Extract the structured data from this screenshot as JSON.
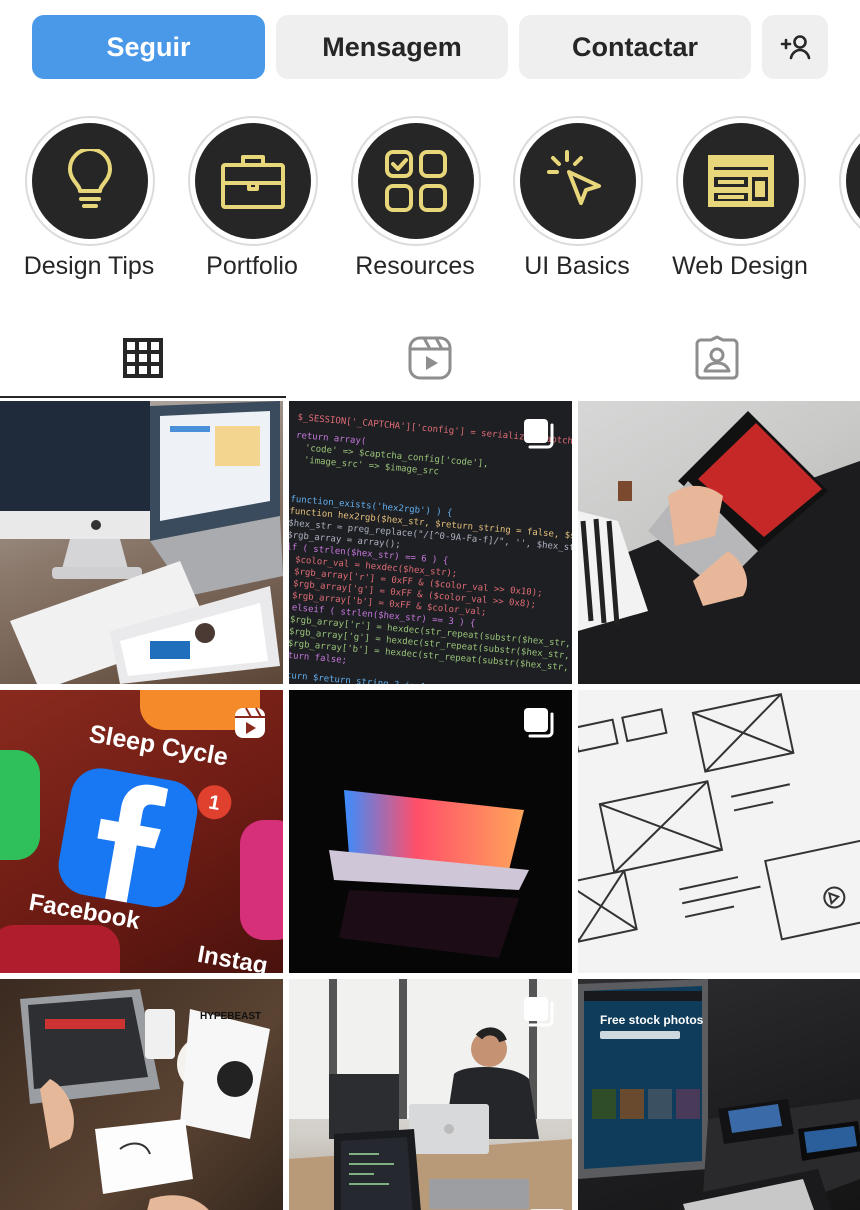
{
  "actions": {
    "follow_label": "Seguir",
    "message_label": "Mensagem",
    "contact_label": "Contactar",
    "add_person_icon": "add-person-icon"
  },
  "highlights": [
    {
      "label": "Design Tips",
      "icon": "lightbulb-icon"
    },
    {
      "label": "Portfolio",
      "icon": "briefcase-icon"
    },
    {
      "label": "Resources",
      "icon": "apps-grid-icon"
    },
    {
      "label": "UI Basics",
      "icon": "cursor-click-icon"
    },
    {
      "label": "Web Design",
      "icon": "layout-icon"
    }
  ],
  "tabs": [
    {
      "name": "posts",
      "icon": "grid-icon",
      "active": true
    },
    {
      "name": "reels",
      "icon": "reels-icon",
      "active": false
    },
    {
      "name": "tagged",
      "icon": "tagged-person-icon",
      "active": false
    }
  ],
  "colors": {
    "follow_button": "#4a99e9",
    "secondary_button": "#efefef",
    "highlight_circle": "#262626",
    "highlight_icon": "#e8d77a",
    "text": "#262626"
  },
  "posts": [
    {
      "subject": "iMac, MacBook and iPad on wooden desk",
      "badge": null
    },
    {
      "subject": "PHP code on dark screen",
      "badge": "carousel-icon"
    },
    {
      "subject": "Person using laptop on lap",
      "badge": null
    },
    {
      "subject": "Facebook app icon on phone",
      "badge": "reels-icon"
    },
    {
      "subject": "Glowing laptop in darkness",
      "badge": "carousel-icon"
    },
    {
      "subject": "Wireframe sketches on paper",
      "badge": null
    },
    {
      "subject": "Top view of desk with coffee and laptop",
      "badge": null
    },
    {
      "subject": "Man working in office with laptops",
      "badge": "carousel-icon"
    },
    {
      "subject": "Laptop showing free stock photos site",
      "badge": null
    }
  ],
  "post_texts": {
    "post4_app1": "Sleep Cycle",
    "post4_app2": "Facebook",
    "post4_app3": "Instag",
    "post4_badge_count": "1",
    "post7_magazine": "HYPEBEAST",
    "post9_screen": "Free stock photos"
  }
}
